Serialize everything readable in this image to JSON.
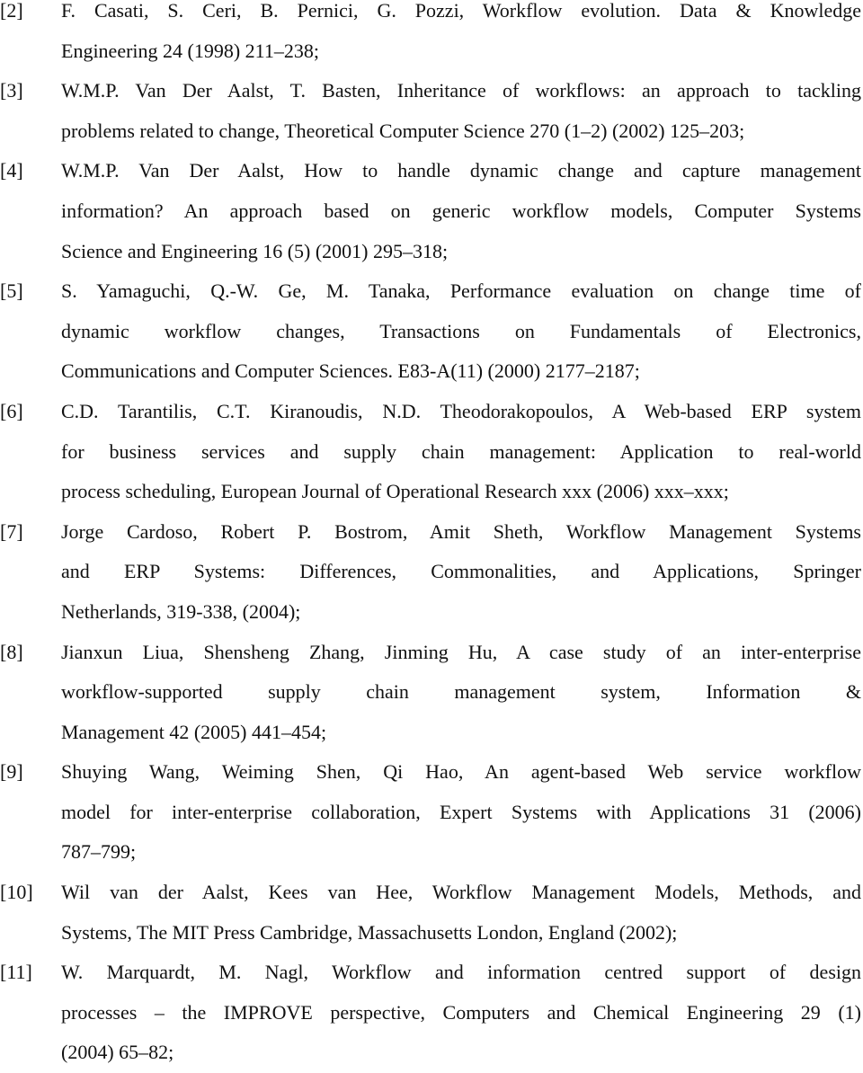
{
  "references": [
    {
      "num": "[2]",
      "lines": [
        "F. Casati, S. Ceri, B. Pernici, G. Pozzi, Workflow evolution. Data & Knowledge",
        "Engineering 24 (1998) 211–238;"
      ]
    },
    {
      "num": "[3]",
      "lines": [
        "W.M.P. Van Der Aalst, T. Basten, Inheritance of workflows: an approach to tackling",
        "problems related to change, Theoretical Computer Science 270 (1–2) (2002) 125–203;"
      ]
    },
    {
      "num": "[4]",
      "lines": [
        "W.M.P. Van Der Aalst, How to handle dynamic change and capture management",
        "information? An approach based on generic workflow models, Computer Systems",
        "Science and Engineering 16 (5) (2001) 295–318;"
      ]
    },
    {
      "num": "[5]",
      "lines": [
        "S. Yamaguchi, Q.-W. Ge, M. Tanaka, Performance evaluation on change time of",
        "dynamic workflow changes, Transactions on Fundamentals of Electronics,",
        "Communications and Computer Sciences. E83-A(11) (2000) 2177–2187;"
      ]
    },
    {
      "num": "[6]",
      "lines": [
        "C.D. Tarantilis, C.T. Kiranoudis, N.D. Theodorakopoulos, A Web-based ERP system",
        "for business services and supply chain management: Application to real-world",
        "process scheduling, European Journal of Operational Research xxx (2006) xxx–xxx;"
      ]
    },
    {
      "num": "[7]",
      "lines": [
        "Jorge Cardoso, Robert P. Bostrom, Amit Sheth, Workflow Management Systems",
        "and ERP Systems: Differences, Commonalities, and Applications, Springer",
        "Netherlands, 319-338, (2004);"
      ]
    },
    {
      "num": "[8]",
      "lines": [
        "Jianxun Liua, Shensheng Zhang, Jinming Hu, A case study of an inter-enterprise",
        "workflow-supported supply chain management system, Information &",
        "Management 42 (2005) 441–454;"
      ]
    },
    {
      "num": "[9]",
      "lines": [
        "Shuying Wang, Weiming Shen, Qi Hao, An agent-based Web service workflow",
        "model for inter-enterprise collaboration, Expert Systems with Applications 31 (2006)",
        "787–799;"
      ]
    },
    {
      "num": "[10]",
      "lines": [
        "Wil van der Aalst, Kees van Hee, Workflow Management Models, Methods, and",
        "Systems, The MIT Press Cambridge, Massachusetts London, England  (2002);"
      ]
    },
    {
      "num": "[11]",
      "lines": [
        "W. Marquardt, M. Nagl, Workflow and information centred support of design",
        "processes – the IMPROVE perspective, Computers and Chemical Engineering 29 (1)",
        "(2004) 65–82;"
      ]
    }
  ]
}
